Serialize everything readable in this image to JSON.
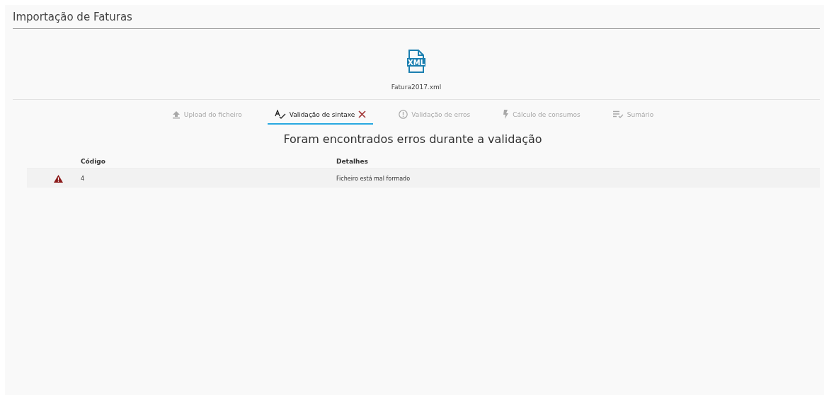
{
  "title": "Importação de Faturas",
  "file": {
    "badge": "XML",
    "name": "Fatura2017.xml"
  },
  "steps": [
    {
      "label": "Upload do ficheiro",
      "kind": "upload",
      "selected": false,
      "failed": false
    },
    {
      "label": "Validação de sintaxe",
      "kind": "spellcheck",
      "selected": true,
      "failed": true
    },
    {
      "label": "Validação de erros",
      "kind": "alert",
      "selected": false,
      "failed": false
    },
    {
      "label": "Cálculo de consumos",
      "kind": "bolt",
      "selected": false,
      "failed": false
    },
    {
      "label": "Sumário",
      "kind": "checklist",
      "selected": false,
      "failed": false
    }
  ],
  "heading": "Foram encontrados erros durante a validação",
  "table": {
    "columns": [
      "Código",
      "Detalhes"
    ],
    "rows": [
      {
        "error": true,
        "code": "4",
        "details": "Ficheiro está mal formado"
      }
    ]
  }
}
